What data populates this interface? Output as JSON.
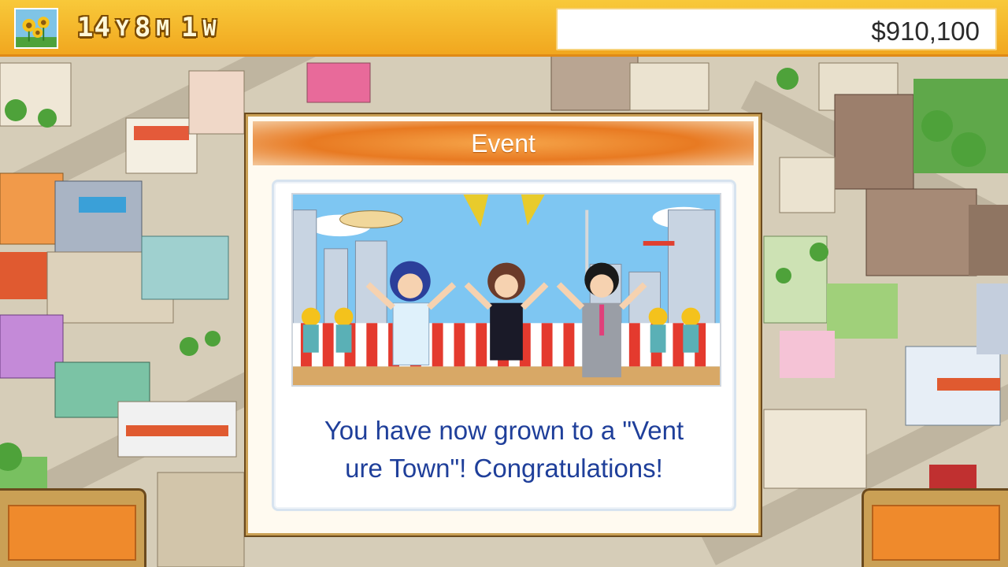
{
  "header": {
    "season_icon": "sunflower-icon",
    "date": {
      "years": "14",
      "years_unit": "Y",
      "months": "8",
      "months_unit": "M",
      "weeks": "1",
      "weeks_unit": "W"
    },
    "money": "$910,100"
  },
  "event_dialog": {
    "title": "Event",
    "message": "You have now grown to a \"Vent\nure Town\"! Congratulations!"
  },
  "colors": {
    "topbar": "#f4b72a",
    "dialog_header": "#e87a22",
    "message_text": "#1f3f9a",
    "corner_button": "#ef8a2c"
  }
}
